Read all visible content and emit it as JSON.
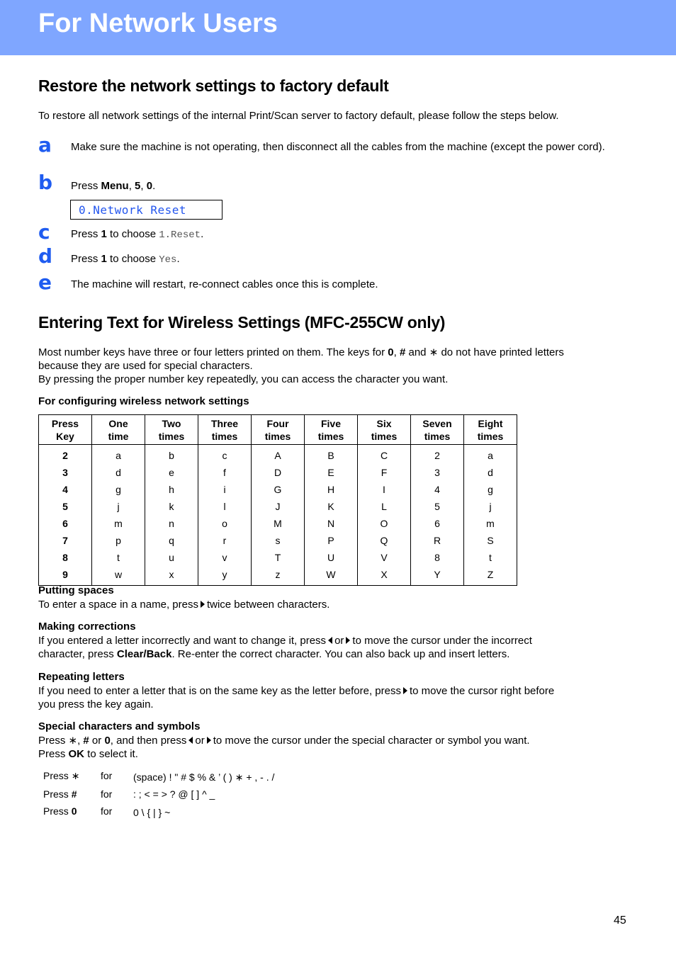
{
  "header": {
    "title": "For Network Users",
    "color": "#7fa6ff"
  },
  "section1": {
    "title": "Restore the network settings to factory default",
    "intro": "To restore all network settings of the internal Print/Scan server to factory default, please follow the steps below.",
    "steps": [
      {
        "letter": "a",
        "text": "Make sure the machine is not operating, then disconnect all the cables from the machine (except the power cord)."
      },
      {
        "letter": "b",
        "prefix": "Press ",
        "bold1": "Menu",
        "sep1": ", ",
        "bold2": "5",
        "sep2": ", ",
        "bold3": "0",
        "suffix": "."
      },
      {
        "letter": "c",
        "prefix": "Press ",
        "bold": "1",
        "middle": " to choose ",
        "mono": "1.Reset",
        "suffix": "."
      },
      {
        "letter": "d",
        "prefix": "Press ",
        "bold": "1",
        "middle": " to choose ",
        "mono": "Yes",
        "suffix": "."
      },
      {
        "letter": "e",
        "text": "The machine will restart, re-connect cables once this is complete."
      }
    ],
    "lcd_display": "0.Network Reset"
  },
  "section2": {
    "title": "Entering Text for Wireless Settings (MFC-255CW only)",
    "intro_line1_a": "Most number keys have three or four letters printed on them. The keys for ",
    "intro_line1_b0": "0",
    "intro_line1_c": ", ",
    "intro_line1_bhash": "#",
    "intro_line1_d": " and ",
    "intro_line1_star": "∗",
    "intro_line1_e": " do not have printed letters",
    "intro_line2": "because they are used for special characters.",
    "intro_line3": "By pressing the proper number key repeatedly, you can access the character you want.",
    "table_caption": "For configuring wireless network settings",
    "table": {
      "headers": [
        [
          "Press",
          "Key"
        ],
        [
          "One",
          "time"
        ],
        [
          "Two",
          "times"
        ],
        [
          "Three",
          "times"
        ],
        [
          "Four",
          "times"
        ],
        [
          "Five",
          "times"
        ],
        [
          "Six",
          "times"
        ],
        [
          "Seven",
          "times"
        ],
        [
          "Eight",
          "times"
        ]
      ],
      "rows": [
        [
          "2",
          "a",
          "b",
          "c",
          "A",
          "B",
          "C",
          "2",
          "a"
        ],
        [
          "3",
          "d",
          "e",
          "f",
          "D",
          "E",
          "F",
          "3",
          "d"
        ],
        [
          "4",
          "g",
          "h",
          "i",
          "G",
          "H",
          "I",
          "4",
          "g"
        ],
        [
          "5",
          "j",
          "k",
          "l",
          "J",
          "K",
          "L",
          "5",
          "j"
        ],
        [
          "6",
          "m",
          "n",
          "o",
          "M",
          "N",
          "O",
          "6",
          "m"
        ],
        [
          "7",
          "p",
          "q",
          "r",
          "s",
          "P",
          "Q",
          "R",
          "S"
        ],
        [
          "8",
          "t",
          "u",
          "v",
          "T",
          "U",
          "V",
          "8",
          "t"
        ],
        [
          "9",
          "w",
          "x",
          "y",
          "z",
          "W",
          "X",
          "Y",
          "Z"
        ]
      ]
    },
    "putting_spaces": {
      "title": "Putting spaces",
      "text_a": "To enter a space in a name, press",
      "text_b": "twice between characters."
    },
    "making_corrections": {
      "title": "Making corrections",
      "line1_a": "If you entered a letter incorrectly and want to change it, press",
      "line1_or": "or",
      "line1_b": "to move the cursor under the incorrect",
      "line2_a": "character, press ",
      "line2_bold": "Clear/Back",
      "line2_b": ". Re-enter the correct character. You can also back up and insert letters."
    },
    "repeating_letters": {
      "title": "Repeating letters",
      "line1_a": "If you need to enter a letter that is on the same key as the letter before, press",
      "line1_b": "to move the cursor right before",
      "line2": "you press the key again."
    },
    "special_characters": {
      "title": "Special characters and symbols",
      "line1_a": "Press ∗, ",
      "line1_hash": "#",
      "line1_or": " or ",
      "line1_zero": "0",
      "line1_b": ", and then press",
      "line1_or2": "or",
      "line1_c": "to move the cursor under the special character or symbol you want.",
      "line2_a": "Press ",
      "line2_bold": "OK",
      "line2_b": " to select it.",
      "list": [
        {
          "press": "Press ",
          "key": "∗",
          "key_bold": false,
          "for": "for",
          "chars": "(space) ! \" # $ % & ’ ( ) ∗ + , - . /"
        },
        {
          "press": "Press ",
          "key": "#",
          "key_bold": true,
          "for": "for",
          "chars": ": ; < = > ? @ [ ] ^ _"
        },
        {
          "press": "Press ",
          "key": "0",
          "key_bold": true,
          "for": "for",
          "chars": "0 \\ { | } ~"
        }
      ]
    }
  },
  "footer": {
    "page_number": "45"
  }
}
